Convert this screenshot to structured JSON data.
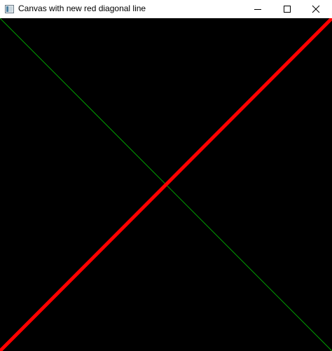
{
  "window": {
    "title": "Canvas with new red diagonal line"
  },
  "icons": {
    "app": "window-app-icon",
    "minimize": "minimize-icon",
    "maximize": "maximize-icon",
    "close": "close-icon"
  },
  "canvas": {
    "background": "#000000",
    "lines": [
      {
        "name": "green-diagonal-line",
        "color": "#00a000",
        "direction": "top-left to bottom-right"
      },
      {
        "name": "red-diagonal-line",
        "color": "#ff0000",
        "direction": "bottom-left to top-right"
      }
    ]
  }
}
